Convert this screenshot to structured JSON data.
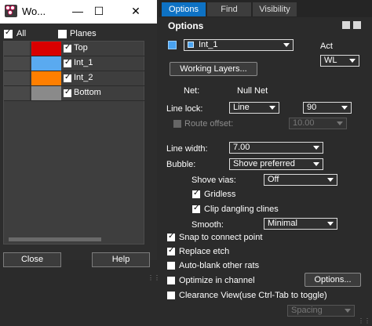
{
  "left_window": {
    "title": "Wo...",
    "all_label": "All",
    "planes_label": "Planes",
    "layers": [
      {
        "name": "Top",
        "color": "#d90000",
        "checked": true
      },
      {
        "name": "Int_1",
        "color": "#5aaaf0",
        "checked": true
      },
      {
        "name": "Int_2",
        "color": "#ff7f00",
        "checked": true
      },
      {
        "name": "Bottom",
        "color": "#8a8a8a",
        "checked": true
      }
    ],
    "close_label": "Close",
    "help_label": "Help"
  },
  "tabs": [
    {
      "label": "Options",
      "active": true
    },
    {
      "label": "Find",
      "active": false
    },
    {
      "label": "Visibility",
      "active": false
    }
  ],
  "options": {
    "title": "Options",
    "layer_value": "Int_1",
    "layer_swatch_color": "#4aa3f0",
    "act_label": "Act",
    "act_value": "WL",
    "working_layers_label": "Working Layers...",
    "net_label": "Net:",
    "net_value": "Null Net",
    "line_lock_label": "Line lock:",
    "line_lock_value": "Line",
    "line_lock_angle": "90",
    "route_offset_label": "Route offset:",
    "route_offset_value": "10.00",
    "line_width_label": "Line width:",
    "line_width_value": "7.00",
    "bubble_label": "Bubble:",
    "bubble_value": "Shove preferred",
    "shove_vias_label": "Shove vias:",
    "shove_vias_value": "Off",
    "gridless_label": "Gridless",
    "clip_dangling_label": "Clip dangling clines",
    "smooth_label": "Smooth:",
    "smooth_value": "Minimal",
    "snap_label": "Snap to connect point",
    "replace_etch_label": "Replace etch",
    "auto_blank_label": "Auto-blank other rats",
    "optimize_label": "Optimize in channel",
    "options_button_label": "Options...",
    "clearance_label": "Clearance View(use Ctrl-Tab to toggle)",
    "spacing_value": "Spacing"
  }
}
